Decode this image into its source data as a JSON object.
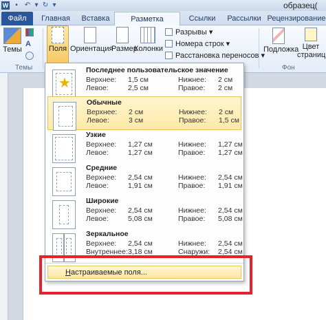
{
  "window": {
    "doc_title": "образец("
  },
  "tabs": [
    {
      "label": "Файл"
    },
    {
      "label": "Главная"
    },
    {
      "label": "Вставка"
    },
    {
      "label": "Разметка страницы"
    },
    {
      "label": "Ссылки"
    },
    {
      "label": "Рассылки"
    },
    {
      "label": "Рецензирование"
    }
  ],
  "ribbon": {
    "themes_label": "Темы",
    "themes_group": "Темы",
    "fields_label": "Поля",
    "orientation_label": "Ориентация",
    "size_label": "Размер",
    "columns_label": "Колонки",
    "breaks_label": "Разрывы",
    "line_numbers_label": "Номера строк",
    "hyphenation_label": "Расстановка переносов",
    "watermark_label": "Подложка",
    "page_color_label": "Цвет страницы",
    "page_bg_group": "Фон страницы"
  },
  "margins_menu": {
    "presets": [
      {
        "title": "Последнее пользовательское значение",
        "top_label": "Верхнее:",
        "top": "1,5 см",
        "bottom_label": "Нижнее:",
        "bottom": "2 см",
        "left_label": "Левое:",
        "left": "2,5 см",
        "right_label": "Правое:",
        "right": "2 см"
      },
      {
        "title": "Обычные",
        "top_label": "Верхнее:",
        "top": "2 см",
        "bottom_label": "Нижнее:",
        "bottom": "2 см",
        "left_label": "Левое:",
        "left": "3 см",
        "right_label": "Правое:",
        "right": "1,5 см"
      },
      {
        "title": "Узкие",
        "top_label": "Верхнее:",
        "top": "1,27 см",
        "bottom_label": "Нижнее:",
        "bottom": "1,27 см",
        "left_label": "Левое:",
        "left": "1,27 см",
        "right_label": "Правое:",
        "right": "1,27 см"
      },
      {
        "title": "Средние",
        "top_label": "Верхнее:",
        "top": "2,54 см",
        "bottom_label": "Нижнее:",
        "bottom": "2,54 см",
        "left_label": "Левое:",
        "left": "1,91 см",
        "right_label": "Правое:",
        "right": "1,91 см"
      },
      {
        "title": "Широкие",
        "top_label": "Верхнее:",
        "top": "2,54 см",
        "bottom_label": "Нижнее:",
        "bottom": "2,54 см",
        "left_label": "Левое:",
        "left": "5,08 см",
        "right_label": "Правое:",
        "right": "5,08 см"
      },
      {
        "title": "Зеркальное",
        "top_label": "Верхнее:",
        "top": "2,54 см",
        "bottom_label": "Нижнее:",
        "bottom": "2,54 см",
        "left_label": "Внутреннее:",
        "left": "3,18 см",
        "right_label": "Снаружи:",
        "right": "2,54 см"
      }
    ],
    "custom_label": "Настраиваемые поля..."
  },
  "colors": {
    "highlight_box": "#e8202a",
    "file_tab": "#2b579a",
    "hover": "#fde9a8"
  }
}
